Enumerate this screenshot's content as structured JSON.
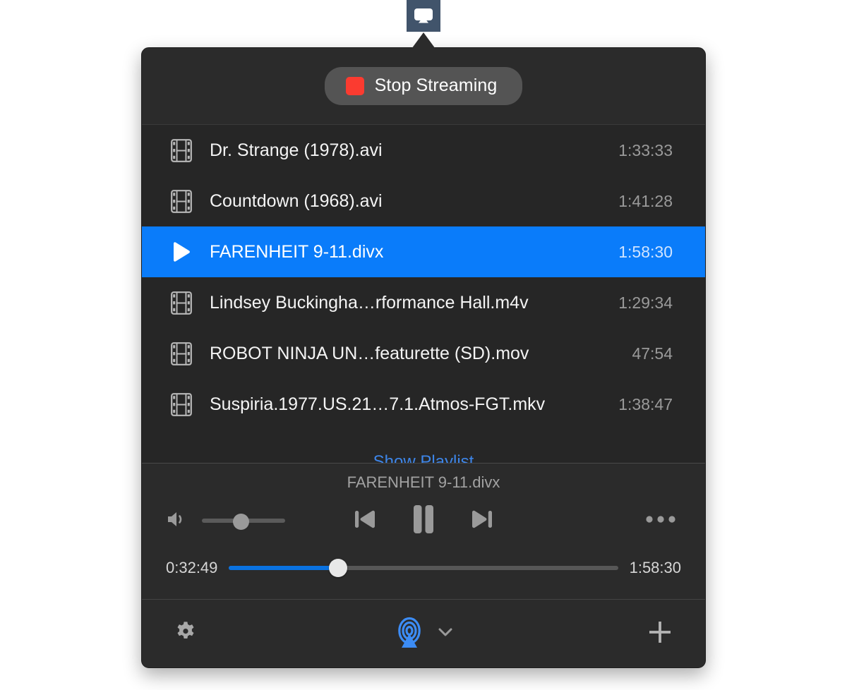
{
  "menubar": {
    "icon": "airplay-icon",
    "active": true,
    "highlight_color": "#41546b"
  },
  "popover": {
    "header": {
      "stop_button": {
        "label": "Stop Streaming",
        "indicator_icon": "stop-square-icon",
        "indicator_color": "#fb3b30"
      }
    },
    "playlist": {
      "show_playlist_link": "Show Playlist",
      "link_color": "#3d85e8",
      "selected_index": 2,
      "selection_color": "#0a7cfa",
      "items": [
        {
          "icon": "film-strip-icon",
          "title": "Dr. Strange (1978).avi",
          "duration": "1:33:33",
          "playing": false
        },
        {
          "icon": "film-strip-icon",
          "title": "Countdown (1968).avi",
          "duration": "1:41:28",
          "playing": false
        },
        {
          "icon": "play-triangle-icon",
          "title": "FARENHEIT 9-11.divx",
          "duration": "1:58:30",
          "playing": true
        },
        {
          "icon": "film-strip-icon",
          "title": "Lindsey Buckingha…rformance Hall.m4v",
          "duration": "1:29:34",
          "playing": false
        },
        {
          "icon": "film-strip-icon",
          "title": "ROBOT NINJA UN…featurette (SD).mov",
          "duration": "47:54",
          "playing": false
        },
        {
          "icon": "film-strip-icon",
          "title": "Suspiria.1977.US.21…7.1.Atmos-FGT.mkv",
          "duration": "1:38:47",
          "playing": false
        }
      ]
    },
    "player": {
      "now_playing": "FARENHEIT 9-11.divx",
      "volume_icon": "speaker-icon",
      "volume_percent": 50,
      "previous_icon": "previous-track-icon",
      "playpause_icon": "pause-icon",
      "next_icon": "next-track-icon",
      "more_icon": "more-dots-icon",
      "elapsed": "0:32:49",
      "remaining": "1:58:30",
      "progress_percent": 28,
      "progress_color": "#0a72e0"
    },
    "footer": {
      "settings_icon": "gear-icon",
      "airplay_icon": "airplay-broadcast-icon",
      "airplay_color": "#3c8cf5",
      "chevron_icon": "chevron-down-icon",
      "add_icon": "plus-icon"
    }
  }
}
